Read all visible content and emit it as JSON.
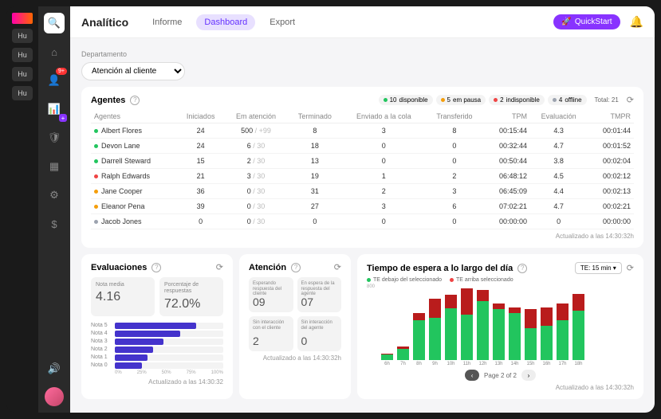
{
  "rail1": {
    "items": [
      "Hu",
      "Hu",
      "Hu",
      "Hu"
    ]
  },
  "topbar": {
    "title": "Analítico",
    "tabs": [
      {
        "label": "Informe",
        "active": false
      },
      {
        "label": "Dashboard",
        "active": true
      },
      {
        "label": "Export",
        "active": false
      }
    ],
    "quickstart": "QuickStart"
  },
  "department": {
    "label": "Departamento",
    "value": "Atención al cliente"
  },
  "agents": {
    "title": "Agentes",
    "status": [
      {
        "color": "g",
        "n": 10,
        "label": "disponible"
      },
      {
        "color": "o",
        "n": 5,
        "label": "em pausa"
      },
      {
        "color": "r",
        "n": 2,
        "label": "indisponible"
      },
      {
        "color": "gr",
        "n": 4,
        "label": "offline"
      }
    ],
    "total_label": "Total:",
    "total": 21,
    "columns": [
      "Agentes",
      "Iniciados",
      "Em atención",
      "Terminado",
      "Enviado a la cola",
      "Transferido",
      "TPM",
      "Evaluación",
      "TMPR"
    ],
    "rows": [
      {
        "dot": "g",
        "name": "Albert Flores",
        "ini": 24,
        "att": "500",
        "att_dim": "/ +99",
        "term": 8,
        "queue": 3,
        "trans": 8,
        "tpm": "00:15:44",
        "eval": 4.3,
        "tmpr": "00:01:44"
      },
      {
        "dot": "g",
        "name": "Devon Lane",
        "ini": 24,
        "att": "6",
        "att_dim": "/ 30",
        "term": 18,
        "queue": 0,
        "trans": 0,
        "tpm": "00:32:44",
        "eval": 4.7,
        "tmpr": "00:01:52"
      },
      {
        "dot": "g",
        "name": "Darrell Steward",
        "ini": 15,
        "att": "2",
        "att_dim": "/ 30",
        "term": 13,
        "queue": 0,
        "trans": 0,
        "tpm": "00:50:44",
        "eval": 3.8,
        "tmpr": "00:02:04"
      },
      {
        "dot": "r",
        "name": "Ralph Edwards",
        "ini": 21,
        "att": "3",
        "att_dim": "/ 30",
        "term": 19,
        "queue": 1,
        "trans": 2,
        "tpm": "06:48:12",
        "eval": 4.5,
        "tmpr": "00:02:12"
      },
      {
        "dot": "o",
        "name": "Jane Cooper",
        "ini": 36,
        "att": "0",
        "att_dim": "/ 30",
        "term": 31,
        "queue": 2,
        "trans": 3,
        "tpm": "06:45:09",
        "eval": 4.4,
        "tmpr": "00:02:13"
      },
      {
        "dot": "o",
        "name": "Eleanor Pena",
        "ini": 39,
        "att": "0",
        "att_dim": "/ 30",
        "term": 27,
        "queue": 3,
        "trans": 6,
        "tpm": "07:02:21",
        "eval": 4.7,
        "tmpr": "00:02:21"
      },
      {
        "dot": "gr",
        "name": "Jacob Jones",
        "ini": 0,
        "att": "0",
        "att_dim": "/ 30",
        "term": 0,
        "queue": 0,
        "trans": 0,
        "tpm": "00:00:00",
        "eval": 0,
        "tmpr": "00:00:00"
      }
    ],
    "updated": "Actualizado a las 14:30:32h"
  },
  "evaluaciones": {
    "title": "Evaluaciones",
    "media_label": "Nota media",
    "media": "4.16",
    "pct_label": "Porcentaje de respuestas",
    "pct": "72.0%",
    "bars": [
      {
        "label": "Nota 5",
        "pct": 75
      },
      {
        "label": "Nota 4",
        "pct": 60
      },
      {
        "label": "Nota 3",
        "pct": 45
      },
      {
        "label": "Nota 2",
        "pct": 35
      },
      {
        "label": "Nota 1",
        "pct": 30
      },
      {
        "label": "Nota 0",
        "pct": 25
      }
    ],
    "axis": [
      "0%",
      "25%",
      "50%",
      "75%",
      "100%"
    ],
    "updated": "Actualizado a las 14:30:32"
  },
  "atencion": {
    "title": "Atención",
    "boxes": [
      {
        "label": "Esperando respuesta del cliente",
        "val": "09"
      },
      {
        "label": "En espera de la respuesta del agente",
        "val": "07"
      },
      {
        "label": "Sin interacción con el cliente",
        "val": "2"
      },
      {
        "label": "Sin interacción del agente",
        "val": "0"
      }
    ],
    "updated": "Actualizado a las 14:30:32h"
  },
  "wait": {
    "title": "Tiempo de espera a lo largo del día",
    "te_label": "TE: 15 min",
    "legend": [
      {
        "color": "g",
        "label": "TE debajo del seleccionado"
      },
      {
        "color": "r",
        "label": "TE arriba seleccionado"
      }
    ],
    "ymax": 800,
    "ylabel": "800",
    "pager": {
      "text": "Page 2 of 2"
    },
    "updated": "Actualizado a las 14:30:32h"
  },
  "chart_data": {
    "type": "bar",
    "title": "Tiempo de espera a lo largo del día",
    "xlabel": "",
    "ylabel": "",
    "ylim": [
      0,
      800
    ],
    "categories": [
      "6h",
      "7h",
      "8h",
      "9h",
      "10h",
      "11h",
      "12h",
      "13h",
      "14h",
      "15h",
      "16h",
      "17h",
      "18h"
    ],
    "series": [
      {
        "name": "TE debajo del seleccionado",
        "color": "#22c55e",
        "values": [
          60,
          120,
          420,
          450,
          550,
          480,
          620,
          540,
          500,
          340,
          360,
          420,
          520
        ]
      },
      {
        "name": "TE arriba seleccionado",
        "color": "#b91c1c",
        "values": [
          5,
          20,
          80,
          200,
          140,
          280,
          120,
          60,
          60,
          200,
          200,
          180,
          180
        ]
      }
    ]
  }
}
